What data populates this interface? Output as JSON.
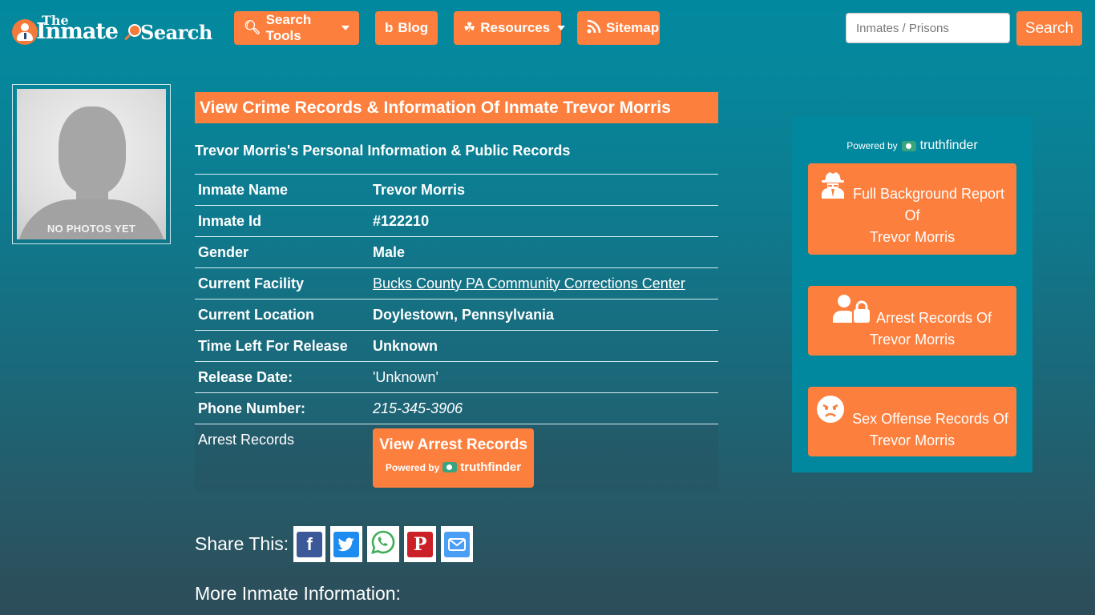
{
  "brand": {
    "name_small": "The",
    "name_main": "Inmate",
    "name_suffix": "Search",
    "colors": {
      "accent": "#fd7f3d",
      "bg_top": "#02889e",
      "bg_bottom": "#2d4c58"
    }
  },
  "nav": {
    "items": [
      {
        "label": "Search Tools",
        "icon": "search-tools-icon",
        "dropdown": true
      },
      {
        "label": "Blog",
        "icon": "blogger-icon",
        "dropdown": false
      },
      {
        "label": "Resources",
        "icon": "leaf-icon",
        "dropdown": true
      },
      {
        "label": "Sitemap",
        "icon": "rss-icon",
        "dropdown": false
      }
    ],
    "search": {
      "placeholder": "Inmates / Prisons",
      "value": "",
      "button_label": "Search"
    }
  },
  "photo": {
    "label": "NO PHOTOS YET"
  },
  "main": {
    "title": "View Crime Records & Information Of Inmate Trevor Morris",
    "subtitle": "Trevor Morris's Personal Information & Public Records",
    "rows": [
      {
        "key": "Inmate Name",
        "value": "Trevor Morris"
      },
      {
        "key": "Inmate Id",
        "value": "#122210"
      },
      {
        "key": "Gender",
        "value": "Male"
      },
      {
        "key": "Current Facility",
        "value": "Bucks County PA Community Corrections Center"
      },
      {
        "key": "Current Location",
        "value": "Doylestown, Pennsylvania"
      },
      {
        "key": "Time Left For Release",
        "value": "Unknown"
      },
      {
        "key": "Release Date:",
        "value": "'Unknown'"
      },
      {
        "key": "Phone Number:",
        "value": "215-345-3906"
      },
      {
        "key": "Arrest Records",
        "value": ""
      }
    ],
    "arrest_button": {
      "label": "View Arrest Records",
      "powered_by": "Powered by",
      "provider": "truthfinder"
    },
    "share_label": "Share This:",
    "share": [
      {
        "name": "facebook",
        "glyph": "f",
        "color": "#3b5998"
      },
      {
        "name": "twitter",
        "glyph": "t",
        "color": "#1d8cf0"
      },
      {
        "name": "whatsapp",
        "glyph": "w",
        "color": "#3fae5a"
      },
      {
        "name": "pinterest",
        "glyph": "P",
        "color": "#cb2027"
      },
      {
        "name": "email",
        "glyph": "✉",
        "color": "#4a9ff5"
      }
    ],
    "more_info": "More Inmate Information:"
  },
  "sidebar": {
    "powered_by": "Powered by",
    "provider": "truthfinder",
    "buttons": [
      {
        "line1": "Full Background Report",
        "line2": "Of",
        "line3": "Trevor Morris",
        "icon": "spy-icon"
      },
      {
        "line1": "Arrest Records Of",
        "line2": "Trevor Morris",
        "icon": "user-lock-icon"
      },
      {
        "line1": "Sex Offense Records Of",
        "line2": "Trevor Morris",
        "icon": "angry-face-icon"
      }
    ]
  }
}
